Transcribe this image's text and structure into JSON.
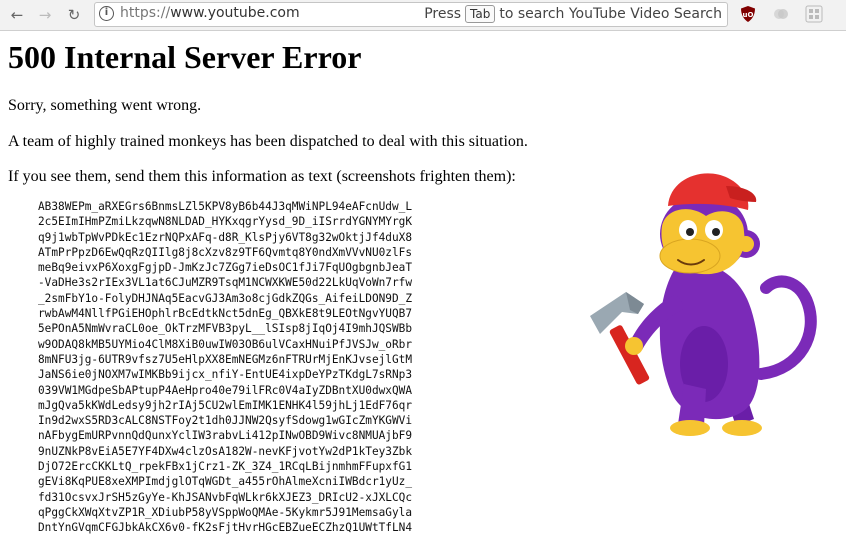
{
  "browser": {
    "back_icon": "arrow-left-icon",
    "forward_icon": "arrow-right-icon",
    "reload_icon": "reload-icon",
    "url_scheme": "https://",
    "url_host": "www.youtube.com",
    "search_hint_prefix": "Press",
    "search_hint_key": "Tab",
    "search_hint_suffix": "to search YouTube Video Search",
    "extensions": [
      "ublock-origin-icon",
      "pocket-icon",
      "hamburger-menu-icon"
    ]
  },
  "page": {
    "title": "500 Internal Server Error",
    "message_1": "Sorry, something went wrong.",
    "message_2": "A team of highly trained monkeys has been dispatched to deal with this situation.",
    "message_3": "If you see them, send them this information as text (screenshots frighten them):",
    "error_code_lines": [
      "AB38WEPm_aRXEGrs6BnmsLZl5KPV8yB6b44J3qMWiNPL94eAFcnUdw_L",
      "2c5EImIHmPZmiLkzqwN8NLDAD_HYKxqgrYysd_9D_iISrrdYGNYMYrgK",
      "q9j1wbTpWvPDkEc1EzrNQPxAFq-d8R_KlsPjy6VT8g32wOktjJf4duX8",
      "ATmPrPpzD6EwQqRzQIIlg8j8cXzv8z9TF6Qvmtq8Y0ndXmVVvNU0zlFs",
      "meBq9eivxP6XoxgFgjpD-JmKzJc7ZGg7ieDsOC1fJi7FqUOgbgnbJeaT",
      "-VaDHe3s2rIEx3VL1at6CJuMZR9TsqM1NCWXKWE50d22LkUqVoWn7rfw",
      "_2smFbY1o-FolyDHJNAq5EacvGJ3Am3o8cjGdkZQGs_AifeiLDON9D_Z",
      "rwbAwM4NllfPGiEHOphlrBcEdtkNct5dnEg_QBXkE8t9LEOtNgvYUQB7",
      "5ePOnA5NmWvraCL0oe_OkTrzMFVB3pyL__lSIsp8jIqOj4I9mhJQSWBb",
      "w9ODAQ8kMB5UYMio4ClM8XiB0uwIW03OB6ulVCaxHNuiPfJVSJw_oRbr",
      "8mNFU3jg-6UTR9vfsz7U5eHlpXX8EmNEGMz6nFTRUrMjEnKJvsejlGtM",
      "JaNS6ie0jNOXM7wIMKBb9ijcx_nfiY-EntUE4ixpDeYPzTKdgL7sRNp3",
      "039VW1MGdpeSbAPtupP4AeHpro40e79ilFRc0V4aIyZDBntXU0dwxQWA",
      "mJgQva5kKWdLedsy9jh2rIAj5CU2wlEmIMK1ENHK4l59jhLj1EdF76qr",
      "In9d2wxS5RD3cALC8NSTFoy2t1dh0JJNW2QsyfSdowg1wGIcZmYKGWVi",
      "nAFbygEmURPvnnQdQunxYclIW3rabvLi412pINwOBD9Wivc8NMUAjbF9",
      "9nUZNkP8vEiA5E7YF4DXw4clzOsA182W-nevKFjvotYw2dP1kTey3Zbk",
      "DjO72ErcCKKLtQ_rpekFBx1jCrz1-ZK_3Z4_1RCqLBijnmhmFFupxfG1",
      "gEVi8KqPUE8xeXMPImdjglOTqWGDt_a455rOhAlmeXcniIWBdcr1yUz_",
      "fd31OcsvxJrSH5zGyYe-KhJSANvbFqWLkr6kXJEZ3_DRIcU2-xJXLCQc",
      "qPggCkXWqXtvZP1R_XDiubP58yVSppWoQMAe-5Kykmr5J91MemsaGyla",
      "DntYnGVqmCFGJbkAkCX6v0-fK2sFjtHvrHGcEBZueECZhzQ1UWtTfLN4"
    ],
    "illustration": "monkey-with-hammer-illustration",
    "colors": {
      "monkey_body": "#7b2ab8",
      "monkey_face": "#f6c431",
      "hat": "#e5312f",
      "hammer_handle": "#d8251f",
      "hammer_head": "#9aa8b2"
    }
  }
}
